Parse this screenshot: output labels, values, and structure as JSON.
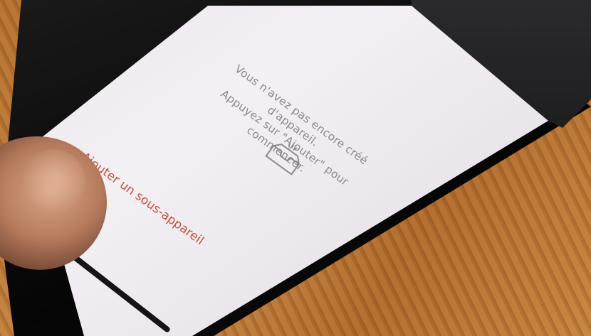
{
  "empty_state": {
    "line1": "Vous n'avez pas encore créé d'appareil.",
    "line2": "Appuyez sur \"Ajouter\" pour commencer.",
    "icon": "empty-tray-icon"
  },
  "bottom_action": {
    "label": "Ajouter un sous-appareil"
  },
  "colors": {
    "accent": "#c7503b",
    "muted_text": "#8e8990",
    "screen_bg": "#efebf0"
  }
}
